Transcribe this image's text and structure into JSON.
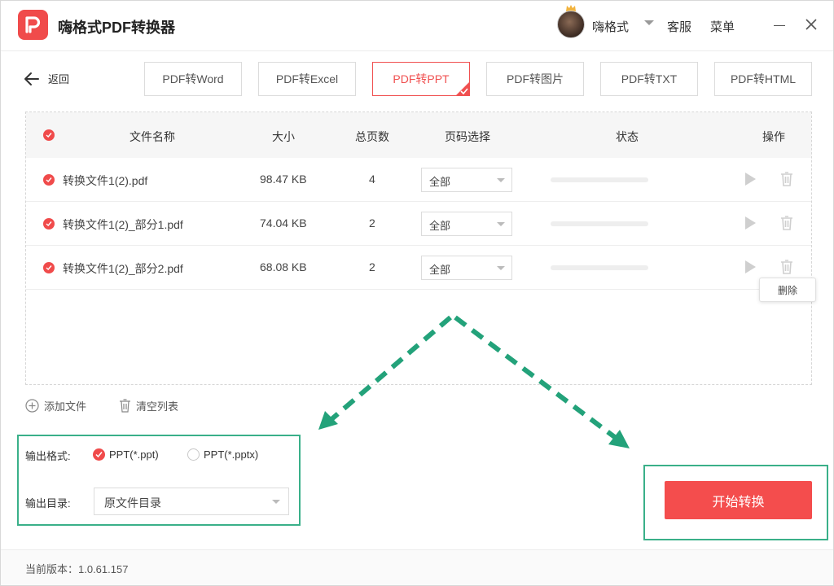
{
  "app": {
    "title": "嗨格式PDF转换器"
  },
  "header": {
    "username": "嗨格式",
    "service": "客服",
    "menu": "菜单"
  },
  "nav": {
    "back_label": "返回"
  },
  "tabs": [
    {
      "label": "PDF转Word"
    },
    {
      "label": "PDF转Excel"
    },
    {
      "label": "PDF转PPT"
    },
    {
      "label": "PDF转图片"
    },
    {
      "label": "PDF转TXT"
    },
    {
      "label": "PDF转HTML"
    }
  ],
  "active_tab_index": 2,
  "table": {
    "headers": {
      "name": "文件名称",
      "size": "大小",
      "pages": "总页数",
      "range": "页码选择",
      "status": "状态",
      "actions": "操作"
    },
    "rows": [
      {
        "name": "转换文件1(2).pdf",
        "size": "98.47 KB",
        "pages": "4",
        "range": "全部",
        "progress": 0
      },
      {
        "name": "转换文件1(2)_部分1.pdf",
        "size": "74.04 KB",
        "pages": "2",
        "range": "全部",
        "progress": 0
      },
      {
        "name": "转换文件1(2)_部分2.pdf",
        "size": "68.08 KB",
        "pages": "2",
        "range": "全部",
        "progress": 0
      }
    ]
  },
  "tooltip": {
    "delete": "删除"
  },
  "actions": {
    "add_file": "添加文件",
    "clear_list": "清空列表"
  },
  "output": {
    "format_label": "输出格式:",
    "format_options": [
      "PPT(*.ppt)",
      "PPT(*.pptx)"
    ],
    "format_selected": 0,
    "dir_label": "输出目录:",
    "dir_value": "原文件目录"
  },
  "start_button": "开始转换",
  "footer": {
    "version": "当前版本：1.0.61.157"
  },
  "colors": {
    "accent": "#f04b4b",
    "highlight": "#3ab089"
  }
}
